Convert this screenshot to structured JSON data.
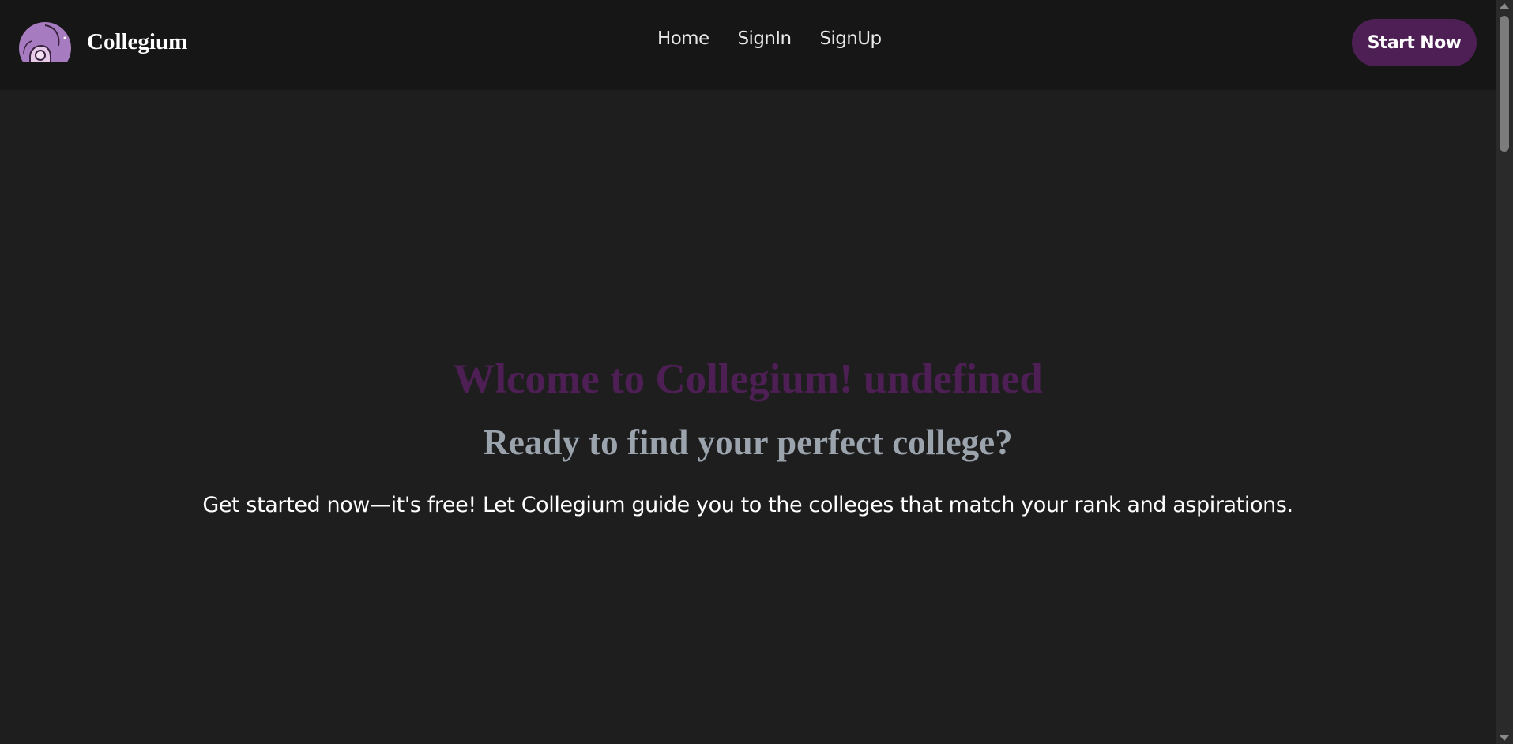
{
  "brand": {
    "name": "Collegium",
    "logo_icon": "graduate-avatar-icon"
  },
  "nav": {
    "links": [
      "Home",
      "SignIn",
      "SignUp"
    ]
  },
  "cta": {
    "label": "Start Now"
  },
  "hero": {
    "title": "Wlcome to Collegium! undefined",
    "subtitle": "Ready to find your perfect college?",
    "text": "Get started now—it's free! Let Collegium guide you to the colleges that match your rank and aspirations."
  },
  "colors": {
    "accent": "#4e1f55",
    "background": "#1e1e1e",
    "navbar": "#161616",
    "subtitle": "#9ba3ad",
    "logo_fill": "#a77bbf"
  }
}
